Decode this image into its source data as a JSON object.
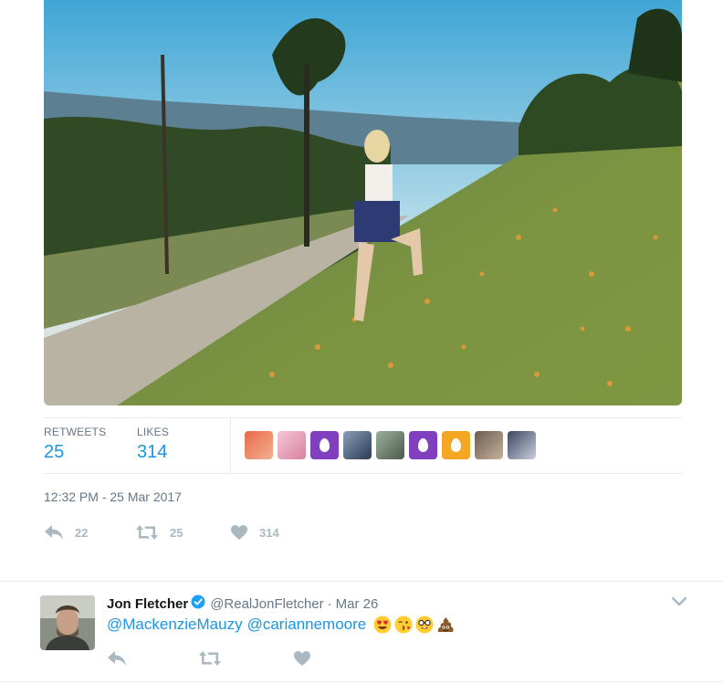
{
  "tweet": {
    "photo_icon": "landscape-photo",
    "stats": {
      "retweets_label": "RETWEETS",
      "retweets_value": "25",
      "likes_label": "LIKES",
      "likes_value": "314"
    },
    "timestamp": "12:32 PM - 25 Mar 2017",
    "actions": {
      "reply_count": "22",
      "retweet_count": "25",
      "like_count": "314"
    }
  },
  "reply": {
    "name": "Jon Fletcher",
    "handle": "@RealJonFletcher",
    "dot": "·",
    "date": "Mar 26",
    "mentions": [
      "@MackenzieMauzy",
      "@cariannemoore"
    ],
    "emojis": [
      "heart-eyes-emoji",
      "kissing-wink-emoji",
      "nerd-face-emoji",
      "pile-of-poo-emoji"
    ]
  },
  "colors": {
    "link": "#1b95e0",
    "muted": "#657786",
    "icon": "#aab8c2",
    "egg_purple": "#7f3fbf",
    "egg_orange": "#f5a623"
  }
}
